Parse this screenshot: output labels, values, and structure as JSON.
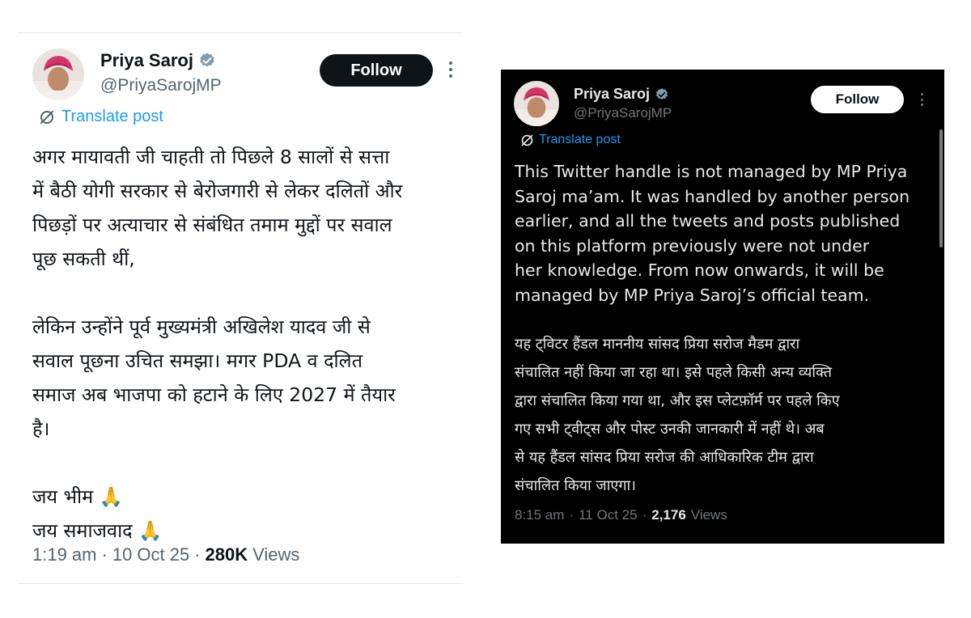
{
  "tweets": [
    {
      "theme": "light",
      "display_name": "Priya Saroj",
      "handle": "@PriyaSarojMP",
      "follow_label": "Follow",
      "translate_label": "Translate post",
      "body": "अगर मायावती जी चाहती तो पिछले 8 सालों से सत्ता\nमें बैठी योगी सरकार से बेरोजगारी से लेकर दलितों और\nपिछड़ों पर अत्याचार से संबंधित तमाम मुद्दों पर सवाल\nपूछ सकती थीं,\n\nलेकिन उन्होंने पूर्व मुख्यमंत्री अखिलेश यादव जी से\nसवाल पूछना उचित समझा। मगर PDA व दलित\nसमाज अब भाजपा को हटाने के लिए 2027 में तैयार\nहै।\n\nजय भीम 🙏\nजय समाजवाद 🙏",
      "time": "1:19 am",
      "date": "10 Oct 25",
      "views_count": "280K",
      "views_label": "Views",
      "separator": "·"
    },
    {
      "theme": "dark",
      "display_name": "Priya Saroj",
      "handle": "@PriyaSarojMP",
      "follow_label": "Follow",
      "translate_label": "Translate post",
      "body_en": "This Twitter handle is not managed by MP Priya\nSaroj ma’am. It was handled by another person\nearlier, and all the tweets and posts published\non this platform previously were not under\nher knowledge. From now onwards, it will be\nmanaged by MP Priya Saroj’s official team.",
      "body_hi": "यह ट्विटर हैंडल माननीय सांसद प्रिया सरोज मैडम द्वारा\nसंचालित नहीं किया जा रहा था। इसे पहले किसी अन्य व्यक्ति\nद्वारा संचालित किया गया था, और इस प्लेटफ़ॉर्म पर पहले किए\nगए सभी ट्वीट्स और पोस्ट उनकी जानकारी में नहीं थे। अब\nसे यह हैंडल सांसद प्रिया सरोज की आधिकारिक टीम द्वारा\nसंचालित किया जाएगा।",
      "time": "8:15 am",
      "date": "11 Oct 25",
      "views_count": "2,176",
      "views_label": "Views",
      "separator": "·"
    }
  ],
  "icons": {
    "verified": "verified-badge-icon",
    "translate": "translate-icon",
    "more": "more-options-icon"
  },
  "colors": {
    "accent": "#1d9bf0",
    "verified_badge": "#829aab",
    "turban": "#d6336c",
    "light_bg": "#ffffff",
    "dark_bg": "#000000"
  }
}
